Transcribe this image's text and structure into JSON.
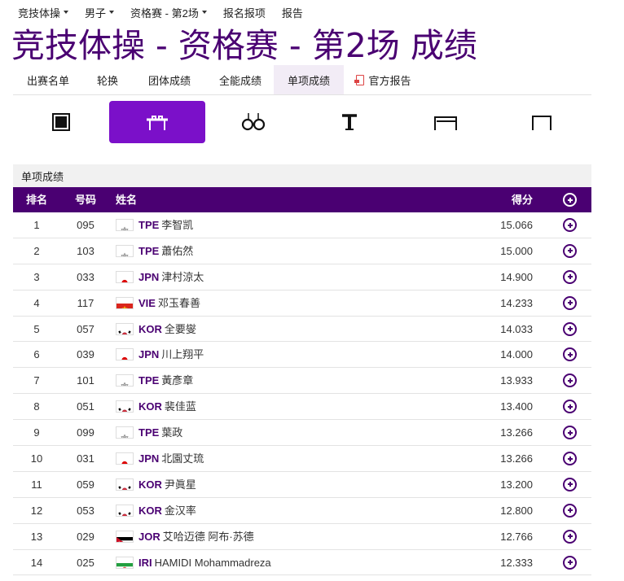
{
  "topnav": [
    {
      "label": "竞技体操",
      "dropdown": true
    },
    {
      "label": "男子",
      "dropdown": true
    },
    {
      "label": "资格赛 - 第2场",
      "dropdown": true
    },
    {
      "label": "报名报项",
      "dropdown": false
    },
    {
      "label": "报告",
      "dropdown": false
    }
  ],
  "page_title": "竞技体操 - 资格赛 - 第2场 成绩",
  "tabs": [
    {
      "label": "出赛名单",
      "active": false
    },
    {
      "label": "轮换",
      "active": false
    },
    {
      "label": "团体成绩",
      "active": false
    },
    {
      "label": "全能成绩",
      "active": false
    },
    {
      "label": "单项成绩",
      "active": true
    },
    {
      "label": "官方报告",
      "active": false,
      "icon": "pdf-icon"
    }
  ],
  "apparatus": [
    {
      "icon": "floor-exercise-icon",
      "active": false
    },
    {
      "icon": "pommel-horse-icon",
      "active": true
    },
    {
      "icon": "rings-icon",
      "active": false
    },
    {
      "icon": "vault-icon",
      "active": false
    },
    {
      "icon": "parallel-bars-icon",
      "active": false
    },
    {
      "icon": "horizontal-bar-icon",
      "active": false
    }
  ],
  "section_title": "单项成绩",
  "table": {
    "headers": {
      "rank": "排名",
      "bib": "号码",
      "name": "姓名",
      "score": "得分"
    },
    "rows": [
      {
        "rank": "1",
        "bib": "095",
        "noc": "TPE",
        "flag": "tpe",
        "name": "李智凯",
        "score": "15.066"
      },
      {
        "rank": "2",
        "bib": "103",
        "noc": "TPE",
        "flag": "tpe",
        "name": "蕭佑然",
        "score": "15.000"
      },
      {
        "rank": "3",
        "bib": "033",
        "noc": "JPN",
        "flag": "jpn",
        "name": "津村涼太",
        "score": "14.900"
      },
      {
        "rank": "4",
        "bib": "117",
        "noc": "VIE",
        "flag": "vie",
        "name": "邓玉春善",
        "score": "14.233"
      },
      {
        "rank": "5",
        "bib": "057",
        "noc": "KOR",
        "flag": "kor",
        "name": "全要燮",
        "score": "14.033"
      },
      {
        "rank": "6",
        "bib": "039",
        "noc": "JPN",
        "flag": "jpn",
        "name": "川上翔平",
        "score": "14.000"
      },
      {
        "rank": "7",
        "bib": "101",
        "noc": "TPE",
        "flag": "tpe",
        "name": "黃彥章",
        "score": "13.933"
      },
      {
        "rank": "8",
        "bib": "051",
        "noc": "KOR",
        "flag": "kor",
        "name": "裴佳蓝",
        "score": "13.400"
      },
      {
        "rank": "9",
        "bib": "099",
        "noc": "TPE",
        "flag": "tpe",
        "name": "葉政",
        "score": "13.266"
      },
      {
        "rank": "10",
        "bib": "031",
        "noc": "JPN",
        "flag": "jpn",
        "name": "北園丈琉",
        "score": "13.266"
      },
      {
        "rank": "11",
        "bib": "059",
        "noc": "KOR",
        "flag": "kor",
        "name": "尹眞星",
        "score": "13.200"
      },
      {
        "rank": "12",
        "bib": "053",
        "noc": "KOR",
        "flag": "kor",
        "name": "金汉率",
        "score": "12.800"
      },
      {
        "rank": "13",
        "bib": "029",
        "noc": "JOR",
        "flag": "jor",
        "name": "艾哈迈德 阿布·苏德",
        "score": "12.766"
      },
      {
        "rank": "14",
        "bib": "025",
        "noc": "IRI",
        "flag": "iri",
        "name": "HAMIDI Mohammadreza",
        "score": "12.333"
      }
    ]
  },
  "colors": {
    "brand": "#4a0072",
    "accent": "#7b10c9",
    "tab_active_bg": "#f2ecf6"
  }
}
